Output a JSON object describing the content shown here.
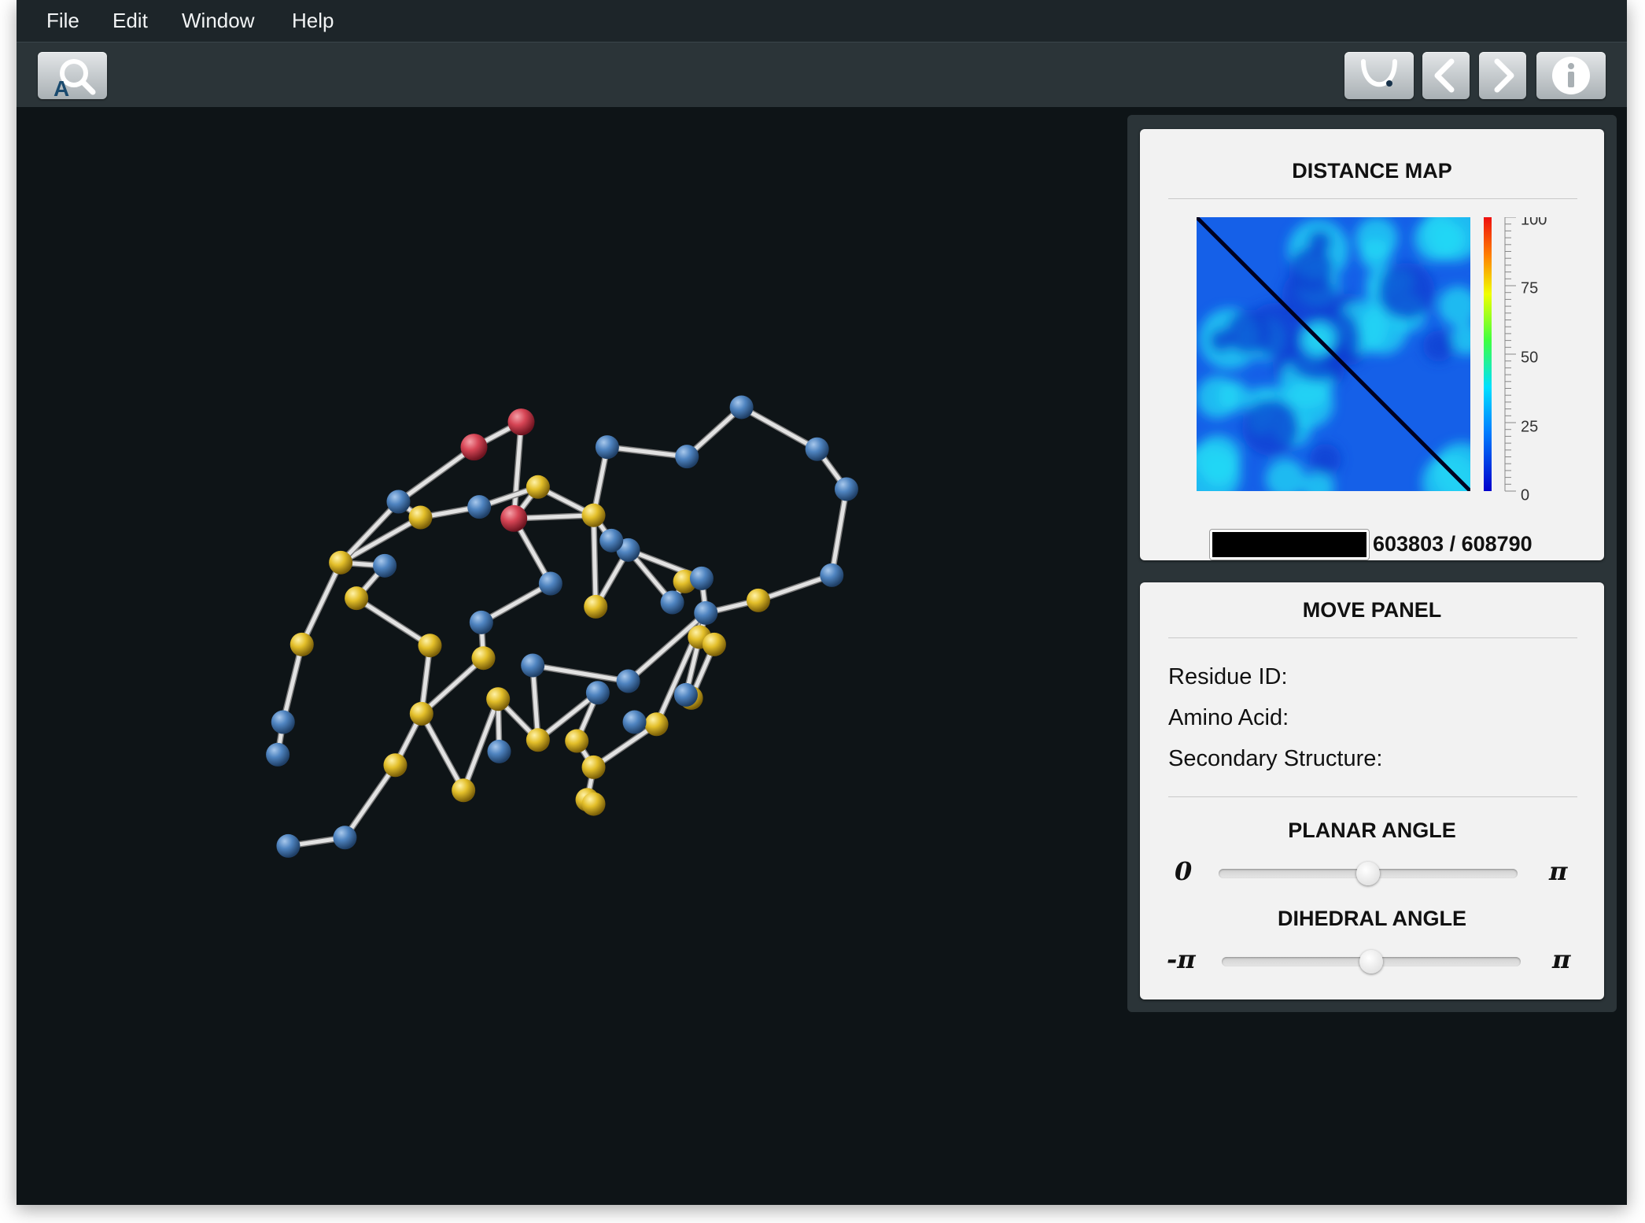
{
  "menu": {
    "file": "File",
    "edit": "Edit",
    "window": "Window",
    "help": "Help"
  },
  "toolbar": {
    "left_buttons": [
      "search-icon"
    ],
    "right_buttons": [
      "lasso-icon",
      "chevron-left-icon",
      "chevron-right-icon",
      "info-icon"
    ]
  },
  "distance_map": {
    "title": "DISTANCE MAP",
    "colorbar_ticks": [
      "100",
      "75",
      "50",
      "25",
      "0"
    ],
    "progress_text": "603803 / 608790",
    "progress_fraction": 0.992
  },
  "move_panel": {
    "title": "MOVE PANEL",
    "residue_id_label": "Residue ID:",
    "amino_acid_label": "Amino Acid:",
    "secondary_structure_label": "Secondary Structure:",
    "planar_angle": {
      "title": "PLANAR ANGLE",
      "min_label": "0",
      "max_label": "π",
      "value_fraction": 0.5
    },
    "dihedral_angle": {
      "title": "DIHEDRAL ANGLE",
      "min_label": "-π",
      "max_label": "π",
      "value_fraction": 0.5
    }
  },
  "colors": {
    "background": "#0e1417",
    "menubar": "#1d2529",
    "toolbar": "#2b3438",
    "atom_blue": "#4f84c0",
    "atom_yellow": "#e3bf2a",
    "atom_red": "#d64555",
    "bond": "#d8d8d8"
  }
}
